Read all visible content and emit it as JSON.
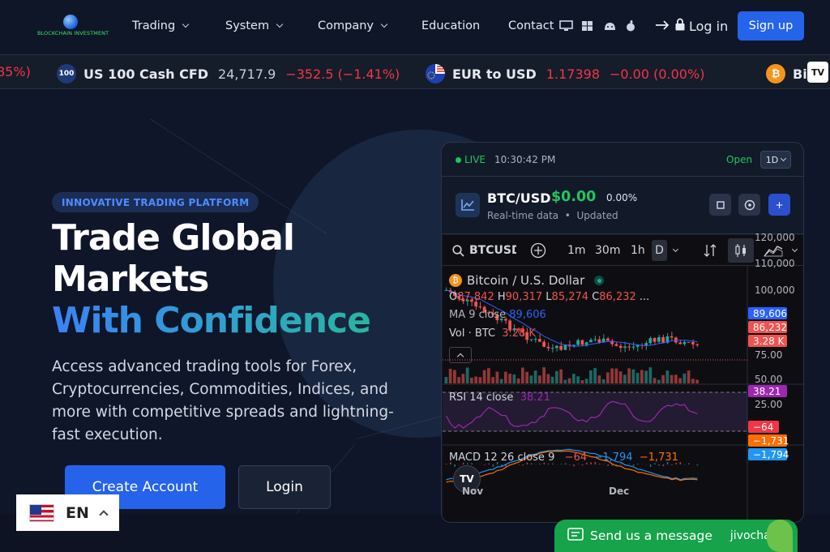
{
  "header": {
    "logo_text": "BLOCKCHAIN INVESTMENT",
    "nav": [
      {
        "label": "Trading",
        "has_dropdown": true
      },
      {
        "label": "System",
        "has_dropdown": true
      },
      {
        "label": "Company",
        "has_dropdown": true
      },
      {
        "label": "Education",
        "has_dropdown": false
      },
      {
        "label": "Contact",
        "has_dropdown": false
      }
    ],
    "os_icons": [
      "desktop-icon",
      "windows-icon",
      "android-icon",
      "apple-icon"
    ],
    "login_label": "Log in",
    "signup_label": "Sign up"
  },
  "ticker": [
    {
      "name": "",
      "price": "",
      "change": "85%)"
    },
    {
      "badge": "100",
      "name": "US 100 Cash CFD",
      "price": "24,717.9",
      "change": "−352.5 (−1.41%)"
    },
    {
      "badge": "",
      "name": "EUR to USD",
      "price": "1.17398",
      "change": "−0.00 (0.00%)"
    },
    {
      "badge": "₿",
      "name": "Bi",
      "price": "",
      "change": ""
    }
  ],
  "hero": {
    "badge": "INNOVATIVE TRADING PLATFORM",
    "title_line1": "Trade Global",
    "title_line2": "Markets",
    "title_line3": "With Confidence",
    "description": "Access advanced trading tools for Forex, Cryptocurrencies, Commodities, Indices, and more with competitive spreads and lightning-fast execution.",
    "primary_button": "Create Account",
    "secondary_button": "Login"
  },
  "card": {
    "live_label": "LIVE",
    "time": "10:30:42 PM",
    "status": "Open",
    "timeframe": "1D",
    "symbol": "BTC/USD",
    "price": "$0.00",
    "change_pct": "0.00%",
    "sub_left": "Real-time data",
    "sub_right": "Updated"
  },
  "tv": {
    "search_value": "BTCUSD",
    "intervals": [
      "1m",
      "30m",
      "1h",
      "D"
    ],
    "title": "Bitcoin / U.S. Dollar",
    "ohlc": {
      "o_label": "O",
      "o": "87,842",
      "h_label": "H",
      "h": "90,317",
      "l_label": "L",
      "l": "85,274",
      "c_label": "C",
      "c": "86,232",
      "more": "..."
    },
    "ma_label": "MA 9 close",
    "ma_value": "89,606",
    "vol_label": "Vol · BTC",
    "vol_value": "3.28 K",
    "rsi_label": "RSI 14 close",
    "rsi_value": "38.21",
    "macd_label": "MACD 12 26 close 9",
    "macd_values": [
      "−64",
      "−1,794",
      "−1,731"
    ],
    "price_scale": [
      "120,000",
      "110,000",
      "100,000"
    ],
    "rsi_scale": [
      "75.00",
      "50.00",
      "25.00"
    ],
    "tags": {
      "ma": "89,606",
      "close": "86,232",
      "vol": "3.28 K",
      "rsi": "38.21",
      "macd_hist": "−64",
      "macd_signal": "−1,731",
      "macd_line": "−1,794"
    },
    "x_labels": [
      "Nov",
      "Dec"
    ],
    "colors": {
      "up": "#26a69a",
      "down": "#ef5350",
      "ma": "#2962ff",
      "rsi": "#9c27b0",
      "macd": "#2196f3",
      "signal": "#ff6d00"
    }
  },
  "language": {
    "code": "EN"
  },
  "chat": {
    "label": "Send us a message",
    "brand": "jivochat"
  }
}
